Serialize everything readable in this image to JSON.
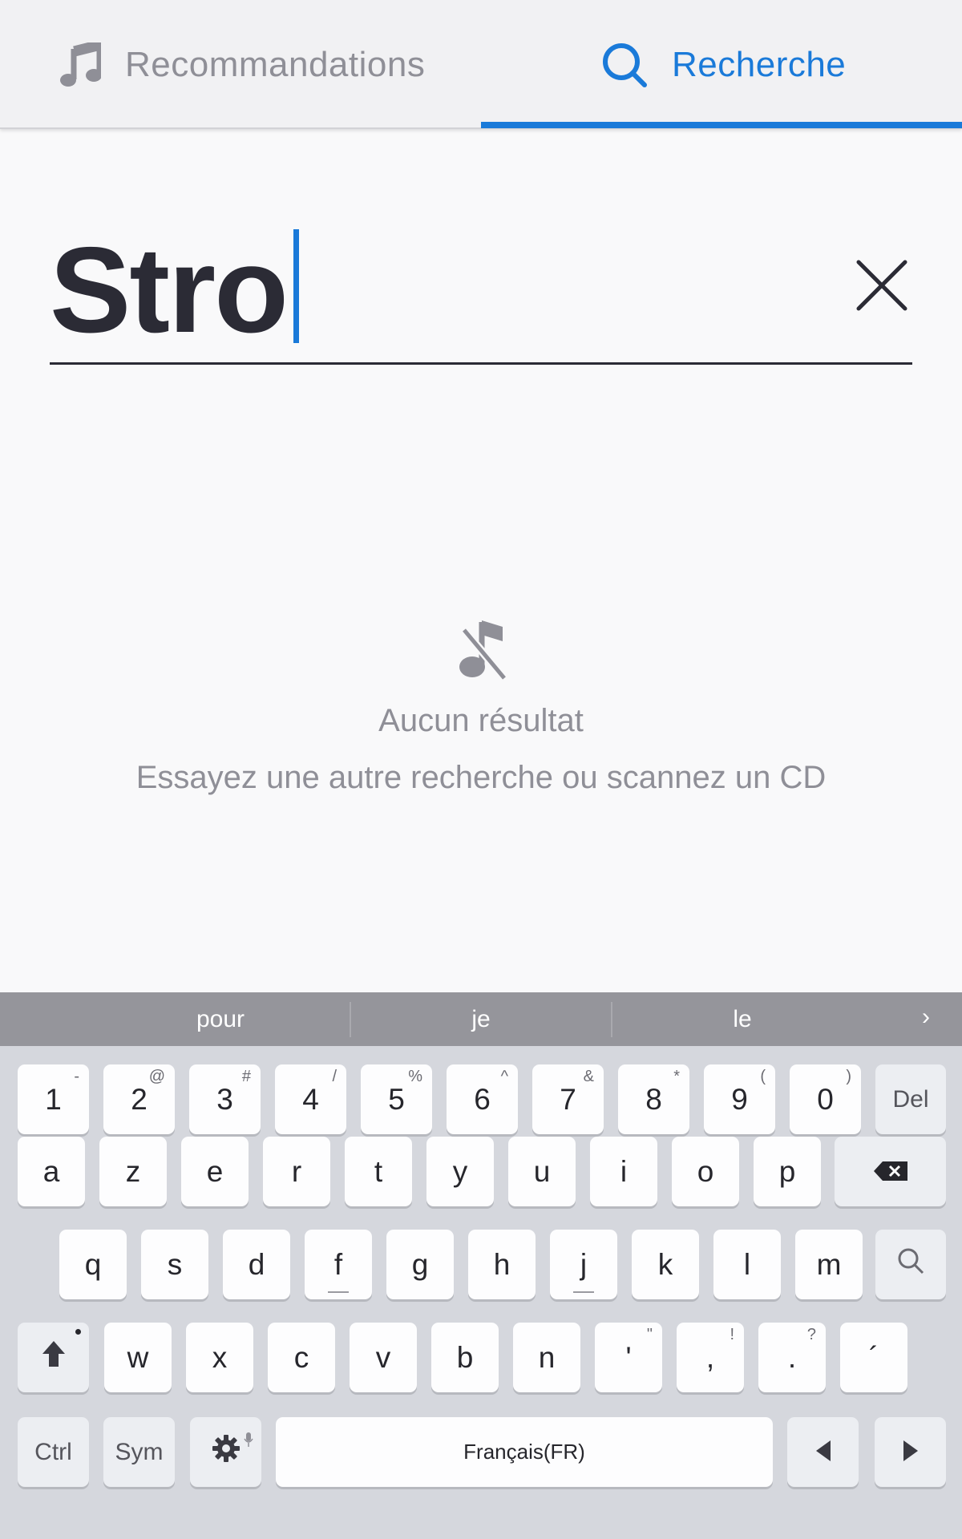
{
  "tabs": {
    "recommendations_label": "Recommandations",
    "search_label": "Recherche",
    "active_color": "#1a7ad9",
    "inactive_color": "#8f8f97"
  },
  "search": {
    "value": "Stro",
    "clear_icon": "close-icon"
  },
  "empty_state": {
    "icon": "music-note-off-icon",
    "title": "Aucun résultat",
    "subtitle": "Essayez une autre recherche ou scannez un CD"
  },
  "keyboard": {
    "suggestions": [
      "pour",
      "je",
      "le"
    ],
    "more": "›",
    "number_row": [
      {
        "k": "1",
        "s": "-"
      },
      {
        "k": "2",
        "s": "@"
      },
      {
        "k": "3",
        "s": "#"
      },
      {
        "k": "4",
        "s": "/"
      },
      {
        "k": "5",
        "s": "%"
      },
      {
        "k": "6",
        "s": "^"
      },
      {
        "k": "7",
        "s": "&"
      },
      {
        "k": "8",
        "s": "*"
      },
      {
        "k": "9",
        "s": "("
      },
      {
        "k": "0",
        "s": ")"
      }
    ],
    "del_label": "Del",
    "row1": [
      "a",
      "z",
      "e",
      "r",
      "t",
      "y",
      "u",
      "i",
      "o",
      "p"
    ],
    "row2": [
      "q",
      "s",
      "d",
      "f",
      "g",
      "h",
      "j",
      "k",
      "l",
      "m"
    ],
    "row3": [
      "w",
      "x",
      "c",
      "v",
      "b",
      "n"
    ],
    "row3_punct": [
      {
        "k": "'",
        "s": "\""
      },
      {
        "k": ",",
        "s": "!"
      },
      {
        "k": ".",
        "s": "?"
      },
      {
        "k": "´",
        "s": ""
      }
    ],
    "ctrl_label": "Ctrl",
    "sym_label": "Sym",
    "space_label": "Français(FR)"
  }
}
